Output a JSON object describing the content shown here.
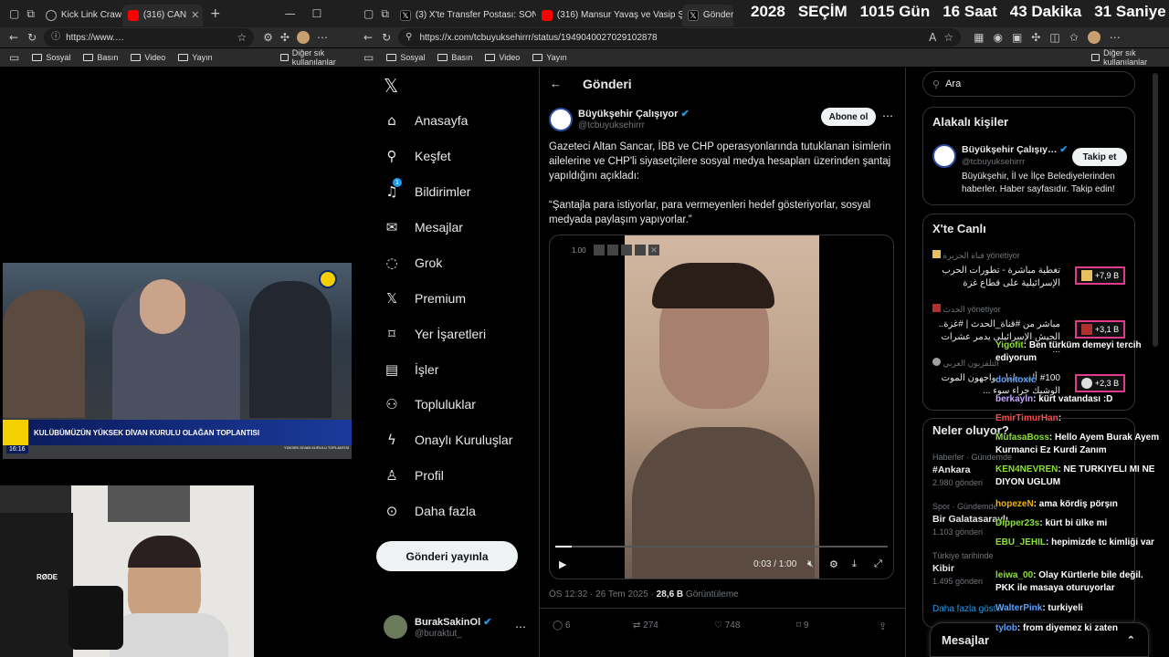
{
  "left_browser": {
    "tabs": [
      {
        "label": "Kick Link Craw",
        "color": "#2a6fdb"
      },
      {
        "label": "(316) CAN",
        "color": "#ff0000"
      }
    ],
    "url": "https://www.…",
    "bookmarks": [
      "Sosyal",
      "Basın",
      "Video",
      "Yayın",
      "Diğer sık kullanılanlar"
    ],
    "video_caption": "KULÜBÜMÜZÜN YÜKSEK DİVAN KURULU OLAĞAN TOPLANTISI",
    "video_time": "16:16",
    "video_subcaption": "YÜKSEK DİVAN KURULU TOPLANTISI",
    "mic_brand": "RØDE"
  },
  "right_browser": {
    "tabs": [
      {
        "label": "(3) X'te Transfer Postası: SON",
        "color": "#000000"
      },
      {
        "label": "(316) Mansur Yavaş ve Vasip Şahin",
        "color": "#ff0000"
      },
      {
        "label": "Gönderiler",
        "color": "#000000"
      }
    ],
    "url": "https://x.com/tcbuyuksehirrr/status/1949040027029102878",
    "bookmarks": [
      "Sosyal",
      "Basın",
      "Video",
      "Yayın",
      "Diğer sık kullanılanlar"
    ]
  },
  "countdown": {
    "year": "2028",
    "label": "SEÇİM",
    "days": "1015 Gün",
    "hours": "16 Saat",
    "minutes": "43 Dakika",
    "seconds": "31 Saniye"
  },
  "x_nav": {
    "items": [
      "Anasayfa",
      "Keşfet",
      "Bildirimler",
      "Mesajlar",
      "Grok",
      "Premium",
      "Yer İşaretleri",
      "İşler",
      "Topluluklar",
      "Onaylı Kuruluşlar",
      "Profil",
      "Daha fazla"
    ],
    "post_button": "Gönderi yayınla",
    "notif_badge": "1",
    "account_name": "BurakSakinOl",
    "account_handle": "@buraktut_"
  },
  "post": {
    "header": "Gönderi",
    "author": "Büyükşehir Çalışıyor",
    "handle": "@tcbuyuksehirrr",
    "subscribe": "Abone ol",
    "text1": "Gazeteci Altan Sancar, İBB ve CHP operasyonlarında tutuklanan isimlerin ailelerine ve CHP'li siyasetçilere sosyal medya hesapları üzerinden şantaj yapıldığını açıkladı:",
    "text2": "“Şantajla para istiyorlar, para vermeyenleri hedef gösteriyorlar, sosyal medyada paylaşım yapıyorlar.”",
    "video_time": "0:03 / 1:00",
    "video_speed": "1.00",
    "date": "ÖS 12:32 · 26 Tem 2025 · ",
    "views": "28,6 B",
    "views_label": " Görüntüleme",
    "actions": {
      "replies": "6",
      "reposts": "274",
      "likes": "748",
      "bookmarks": "9"
    }
  },
  "sidebar": {
    "search_placeholder": "Ara",
    "related_title": "Alakalı kişiler",
    "related_name": "Büyükşehir Çalışıy…",
    "related_handle": "@tcbuyuksehirrr",
    "related_bio": "Büyükşehir, İl ve İlçe Belediyelerinden haberler. Haber sayfasıdır. Takip edin!",
    "follow": "Takip et",
    "live_title": "X'te Canlı",
    "live": [
      {
        "host": "قناة الجزيرة",
        "role": "yönetiyor",
        "title": "تغطية مباشرة - تطورات الحرب الإسرائيلية على قطاع غزة",
        "count": "+7,9 B"
      },
      {
        "host": "الحدث",
        "role": "yönetiyor",
        "title": "مباشر من #قناة_الحدث | #غزة.. الجيش الإسرائيلي يدمر عشرات ...",
        "count": "+3,1 B"
      },
      {
        "host": "التلفزيون العربي",
        "role": "",
        "title": "#100 ألف طفل يواجهون الموت الوشيك جراء سوء ...",
        "count": "+2,3 B"
      }
    ],
    "trends_title": "Neler oluyor?",
    "trends": [
      {
        "meta": "Haberler · Gündemde",
        "name": "#Ankara",
        "count": "2.980 gönderi"
      },
      {
        "meta": "Spor · Gündemde",
        "name": "Bir Galatasaraylı",
        "count": "1.103 gönderi"
      },
      {
        "meta": "Türkiye tarihinde",
        "name": "Kibir",
        "count": "1.495 gönderi"
      }
    ],
    "show_more": "Daha fazla göster",
    "messages": "Mesajlar"
  },
  "chat": [
    {
      "user": "Yigofit",
      "msg": "Ben türküm demeyi tercih ediyorum",
      "color": "#8ae234"
    },
    {
      "user": "donitoxic",
      "msg": "",
      "color": "#5aa0ff"
    },
    {
      "user": "berkayln",
      "msg": "kürt vatandası :D",
      "color": "#c5a3ff"
    },
    {
      "user": "EmirTimurHan",
      "msg": "",
      "color": "#ff4d4d"
    },
    {
      "user": "MufasaBoss",
      "msg": "Hello Ayem Burak Ayem Kurmanci Ez Kurdi Zanım",
      "color": "#8ae234"
    },
    {
      "user": "KEN4NEVREN",
      "msg": "NE TURKIYELI MI NE DIYON UGLUM",
      "color": "#8ae234"
    },
    {
      "user": "hopezeN",
      "msg": "ama kördiş pörşın",
      "color": "#f4b400"
    },
    {
      "user": "Dipper23s",
      "msg": "kürt bi ülke mi",
      "color": "#8ae234"
    },
    {
      "user": "EBU_JEHIL",
      "msg": "hepimizde tc kimliği var",
      "color": "#8ae234"
    },
    {
      "user": "leiwa_00",
      "msg": "Olay Kürtlerle bile değil. PKK ile masaya oturuyorlar",
      "color": "#8ae234"
    },
    {
      "user": "WalterPink",
      "msg": "turkiyeli",
      "color": "#5aa0ff"
    },
    {
      "user": "tylob",
      "msg": "from diyemez ki zaten",
      "color": "#5aa0ff"
    }
  ]
}
